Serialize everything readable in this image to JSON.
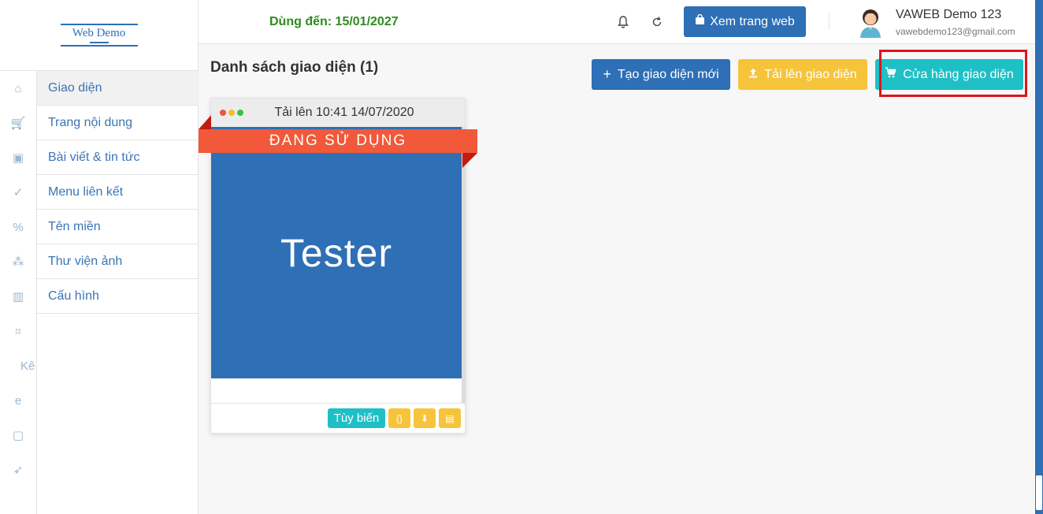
{
  "logo": {
    "text": "Web Demo"
  },
  "sidebar": {
    "rail": [
      {
        "icon": "home-icon",
        "glyph": "⌂"
      },
      {
        "icon": "cart-icon",
        "glyph": "🛒"
      },
      {
        "icon": "bag-icon",
        "glyph": "▣"
      },
      {
        "icon": "user-check-icon",
        "glyph": "✓"
      },
      {
        "icon": "percent-icon",
        "glyph": "%"
      },
      {
        "icon": "network-icon",
        "glyph": "⁂"
      },
      {
        "icon": "chart-icon",
        "glyph": "▥"
      },
      {
        "icon": "crop-icon",
        "glyph": "⌗"
      },
      {
        "icon": "text-fragment",
        "text": "Kê"
      },
      {
        "icon": "browser-icon",
        "glyph": "e"
      },
      {
        "icon": "shopping-bag-icon",
        "glyph": "▢"
      },
      {
        "icon": "rocket-icon",
        "glyph": "➶"
      }
    ],
    "items": [
      {
        "label": "Giao diện"
      },
      {
        "label": "Trang nội dung"
      },
      {
        "label": "Bài viết & tin tức"
      },
      {
        "label": "Menu liên kết"
      },
      {
        "label": "Tên miền"
      },
      {
        "label": "Thư viện ảnh"
      },
      {
        "label": "Cấu hình"
      }
    ]
  },
  "header": {
    "expiry": "Dùng đến: 15/01/2027",
    "view_site": "Xem trang web",
    "user_name": "VAWEB Demo 123",
    "user_email": "vawebdemo123@gmail.com"
  },
  "main": {
    "title": "Danh sách giao diện (1)",
    "btn_new": "Tạo giao diện mới",
    "btn_upload": "Tải lên giao diện",
    "btn_store": "Cửa hàng giao diện"
  },
  "card": {
    "upload_time": "Tải lên 10:41 14/07/2020",
    "ribbon": "ĐANG SỬ DỤNG",
    "preview_text": "Tester",
    "customize": "Tùy biến",
    "code_icon": "{}",
    "download_icon": "⬇",
    "file_icon": "▤"
  },
  "colors": {
    "primary": "#2e6fb6",
    "warning": "#f6c43b",
    "info": "#1ec0c6",
    "ribbon": "#f1593a",
    "highlight": "#e0131b",
    "expiry": "#2e8a1f"
  }
}
